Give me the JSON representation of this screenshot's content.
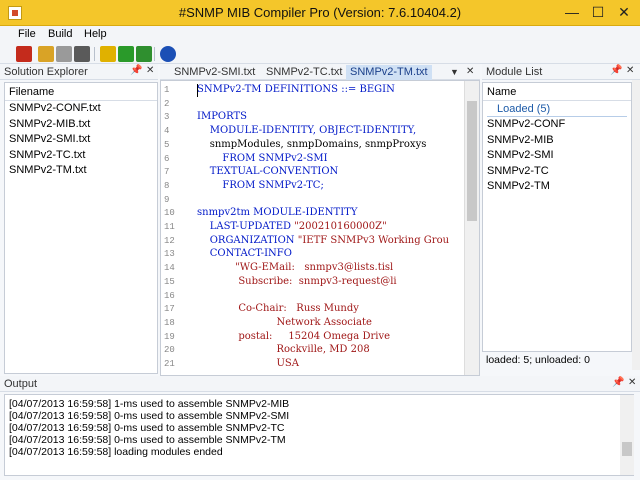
{
  "window": {
    "title": "#SNMP MIB Compiler Pro (Version: 7.6.10404.2)",
    "controls": {
      "minimize": "—",
      "maximize": "☐",
      "close": "✕"
    }
  },
  "menu": [
    "File",
    "Build",
    "Help"
  ],
  "toolbar": {
    "buttons": [
      {
        "icon": "new-project-icon",
        "color": "#c42b1c"
      },
      {
        "icon": "open-folder-icon",
        "color": "#d9a326"
      },
      {
        "icon": "save-icon",
        "color": "#8b8b8b"
      },
      {
        "icon": "close-file-icon",
        "color": "#5a5a5a"
      },
      {
        "icon": "compile-icon",
        "color": "#e0b100"
      },
      {
        "icon": "download-icon",
        "color": "#2a9a2a"
      },
      {
        "icon": "refresh-icon",
        "color": "#2a9a2a"
      },
      {
        "icon": "help-icon",
        "color": "#1b4fb5"
      }
    ]
  },
  "solution_explorer": {
    "title": "Solution Explorer",
    "pin": "📌",
    "close": "✕",
    "column_header": "Filename",
    "files": [
      "SNMPv2-CONF.txt",
      "SNMPv2-MIB.txt",
      "SNMPv2-SMI.txt",
      "SNMPv2-TC.txt",
      "SNMPv2-TM.txt"
    ]
  },
  "editor": {
    "tabs": [
      "SNMPv2-SMI.txt",
      "SNMPv2-TC.txt",
      "SNMPv2-TM.txt"
    ],
    "active_tab": "SNMPv2-TM.txt",
    "dropdown": "▼",
    "close": "✕",
    "lines": [
      {
        "n": "1",
        "text": "SNMPv2-TM DEFINITIONS ::= BEGIN",
        "cls": "kw"
      },
      {
        "n": "2",
        "text": "",
        "cls": ""
      },
      {
        "n": "3",
        "text": "IMPORTS",
        "cls": "kw"
      },
      {
        "n": "4",
        "text": "    MODULE-IDENTITY, OBJECT-IDENTITY,",
        "cls": "kw"
      },
      {
        "n": "5",
        "text": "    snmpModules, snmpDomains, snmpProxys",
        "cls": ""
      },
      {
        "n": "6",
        "text": "        FROM SNMPv2-SMI",
        "cls": "kw"
      },
      {
        "n": "7",
        "text": "    TEXTUAL-CONVENTION",
        "cls": "kw"
      },
      {
        "n": "8",
        "text": "        FROM SNMPv2-TC;",
        "cls": "kw"
      },
      {
        "n": "9",
        "text": "",
        "cls": ""
      },
      {
        "n": "10",
        "text": "snmpv2tm MODULE-IDENTITY",
        "cls": "kw"
      },
      {
        "n": "11",
        "text": "    LAST-UPDATED \"200210160000Z\"",
        "cls": "mix1"
      },
      {
        "n": "12",
        "text": "    ORGANIZATION \"IETF SNMPv3 Working Grou",
        "cls": "mix2"
      },
      {
        "n": "13",
        "text": "    CONTACT-INFO",
        "cls": "kw"
      },
      {
        "n": "14",
        "text": "            \"WG-EMail:   snmpv3@lists.tisl",
        "cls": "st"
      },
      {
        "n": "15",
        "text": "             Subscribe:  snmpv3-request@li",
        "cls": "st"
      },
      {
        "n": "16",
        "text": "",
        "cls": ""
      },
      {
        "n": "17",
        "text": "             Co-Chair:   Russ Mundy",
        "cls": "st"
      },
      {
        "n": "18",
        "text": "                         Network Associate",
        "cls": "st"
      },
      {
        "n": "19",
        "text": "             postal:     15204 Omega Drive",
        "cls": "st"
      },
      {
        "n": "20",
        "text": "                         Rockville, MD 208",
        "cls": "st"
      },
      {
        "n": "21",
        "text": "                         USA",
        "cls": "st"
      }
    ]
  },
  "module_list": {
    "title": "Module List",
    "pin": "📌",
    "close": "✕",
    "column_header": "Name",
    "group": "Loaded (5)",
    "modules": [
      "SNMPv2-CONF",
      "SNMPv2-MIB",
      "SNMPv2-SMI",
      "SNMPv2-TC",
      "SNMPv2-TM"
    ],
    "status": "loaded: 5; unloaded: 0"
  },
  "output": {
    "title": "Output",
    "pin": "📌",
    "close": "✕",
    "lines": [
      "[04/07/2013 16:59:58] 1-ms used to assemble SNMPv2-MIB",
      "[04/07/2013 16:59:58] 0-ms used to assemble SNMPv2-SMI",
      "[04/07/2013 16:59:58] 0-ms used to assemble SNMPv2-TC",
      "[04/07/2013 16:59:58] 0-ms used to assemble SNMPv2-TM",
      "[04/07/2013 16:59:58] loading modules ended"
    ]
  }
}
